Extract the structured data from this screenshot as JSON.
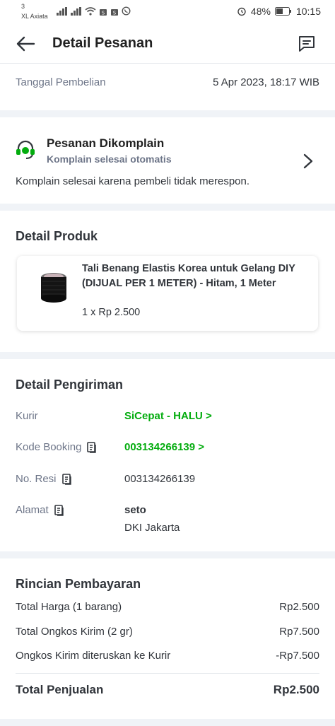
{
  "status_bar": {
    "carrier_num": "3",
    "carrier_name": "XL Axiata",
    "battery": "48%",
    "time": "10:15"
  },
  "app_bar": {
    "title": "Detail Pesanan",
    "back_icon": "arrow-left-icon",
    "chat_icon": "chat-icon"
  },
  "order_date": {
    "label": "Tanggal Pembelian",
    "value": "5 Apr 2023, 18:17 WIB"
  },
  "complaint": {
    "title": "Pesanan Dikomplain",
    "subtitle": "Komplain selesai otomatis",
    "description": "Komplain selesai karena pembeli tidak merespon."
  },
  "product": {
    "section_title": "Detail Produk",
    "name": "Tali Benang Elastis Korea untuk Gelang DIY (DIJUAL PER 1 METER) - Hitam, 1 Meter",
    "qty_price": "1 x Rp 2.500"
  },
  "shipping": {
    "section_title": "Detail Pengiriman",
    "courier_label": "Kurir",
    "courier_value": "SiCepat - HALU >",
    "booking_label": "Kode Booking",
    "booking_value": "003134266139 >",
    "receipt_label": "No. Resi",
    "receipt_value": "003134266139",
    "address_label": "Alamat",
    "address_name": "seto",
    "address_city": "DKI Jakarta"
  },
  "payment": {
    "section_title": "Rincian Pembayaran",
    "rows": [
      {
        "label": "Total Harga (1 barang)",
        "value": "Rp2.500"
      },
      {
        "label": "Total Ongkos Kirim (2 gr)",
        "value": "Rp7.500"
      },
      {
        "label": "Ongkos Kirim diteruskan ke Kurir",
        "value": "-Rp7.500"
      }
    ],
    "total_label": "Total Penjualan",
    "total_value": "Rp2.500"
  },
  "colors": {
    "accent_green": "#03ac0e",
    "text_primary": "#31353b",
    "text_secondary": "#6d7588",
    "divider": "#f0f3f7"
  }
}
